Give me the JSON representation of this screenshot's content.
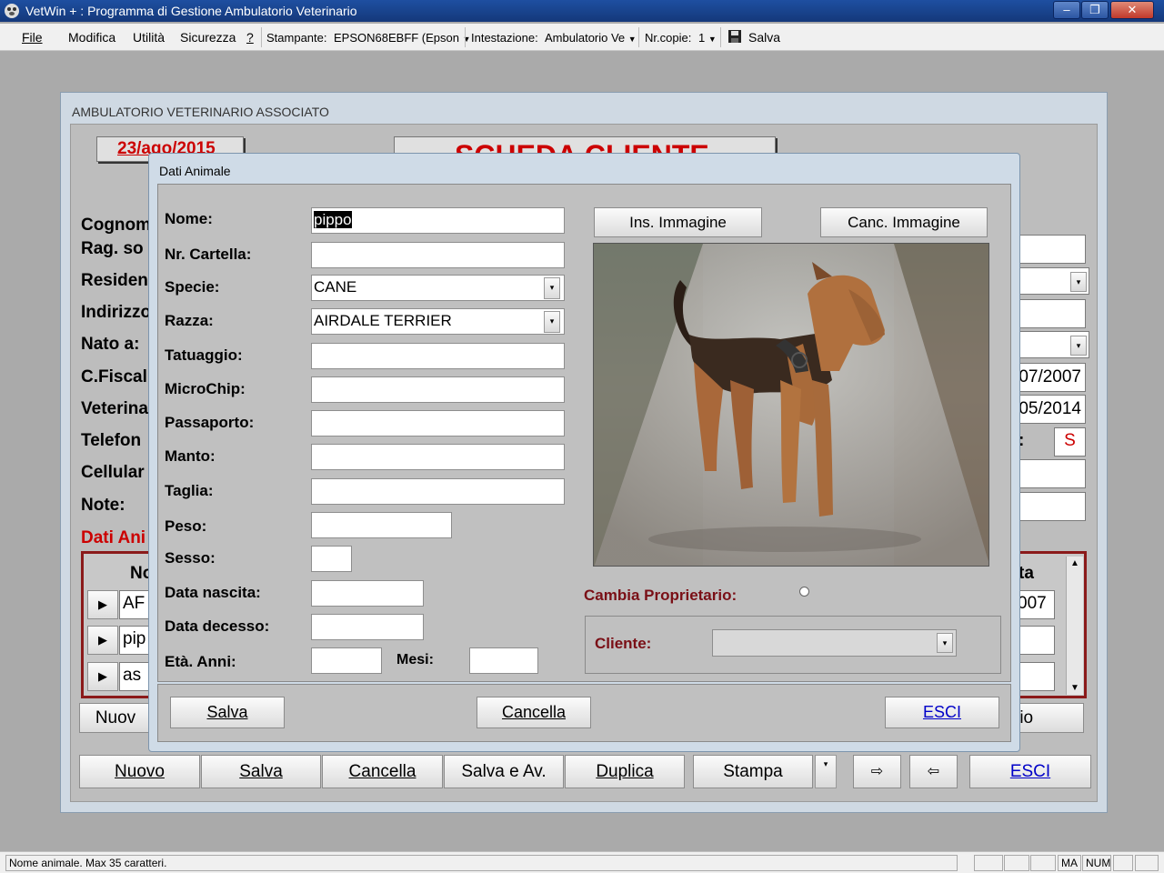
{
  "window": {
    "title": "VetWin + : Programma di Gestione Ambulatorio Veterinario",
    "minimize": "–",
    "maximize": "❐",
    "close": "✕"
  },
  "menu": {
    "file": "File",
    "modifica": "Modifica",
    "utilita": "Utilità",
    "sicurezza": "Sicurezza",
    "help": "?",
    "printer_label": "Stampante:",
    "printer_value": "EPSON68EBFF (Epson",
    "header_label": "Intestazione:",
    "header_value": "Ambulatorio Ve",
    "copies_label": "Nr.copie:",
    "copies_value": "1",
    "save": "Salva"
  },
  "main": {
    "group_title": "AMBULATORIO VETERINARIO ASSOCIATO",
    "date": "23/ago/2015",
    "scheda_title": "SCHEDA CLIENTE",
    "labels": {
      "cognome": "Cognom",
      "ragso": "Rag. so",
      "residenza": "Residen",
      "indirizzo": "Indirizzo",
      "nato": "Nato a:",
      "cfiscale": "C.Fiscal",
      "veterinario": "Veterina",
      "telefono": "Telefon",
      "cellulare": "Cellular",
      "note": "Note:",
      "dati_animali": "Dati Ani"
    },
    "right_values": {
      "date1": "07/2007",
      "date2": "05/2014",
      "s_label": ":",
      "s_value": "S"
    },
    "grid": {
      "col_no": "No",
      "col_ta": "ta",
      "rows": [
        "AF",
        "pip",
        "as"
      ],
      "row0_right": "007"
    },
    "btn_nuovo_partial": "Nuov",
    "btn_rio_partial": "rio",
    "bottom_buttons": {
      "nuovo": "Nuovo",
      "salva": "Salva",
      "cancella": "Cancella",
      "salva_av": "Salva e Av.",
      "duplica": "Duplica",
      "stampa": "Stampa",
      "esci": "ESCI"
    }
  },
  "dialog": {
    "title": "Dati Animale",
    "labels": {
      "nome": "Nome:",
      "cartella": "Nr. Cartella:",
      "specie": "Specie:",
      "razza": "Razza:",
      "tatuaggio": "Tatuaggio:",
      "microchip": "MicroChip:",
      "passaporto": "Passaporto:",
      "manto": "Manto:",
      "taglia": "Taglia:",
      "peso": "Peso:",
      "sesso": "Sesso:",
      "nascita": "Data nascita:",
      "decesso": "Data decesso:",
      "eta": "Età. Anni:",
      "mesi": "Mesi:"
    },
    "values": {
      "nome": "pippo",
      "specie": "CANE",
      "razza": "AIRDALE TERRIER"
    },
    "ins_immagine": "Ins. Immagine",
    "canc_immagine": "Canc. Immagine",
    "cambia_proprietario": "Cambia Proprietario:",
    "cliente": "Cliente:",
    "btn_salva": "Salva",
    "btn_cancella": "Cancella",
    "btn_esci": "ESCI"
  },
  "status": {
    "message": "Nome animale. Max 35 caratteri.",
    "ma": "MA",
    "num": "NUM"
  },
  "colors": {
    "red_text": "#cc0000",
    "maroon_text": "#7a0f16",
    "link_blue": "#0000c8"
  }
}
